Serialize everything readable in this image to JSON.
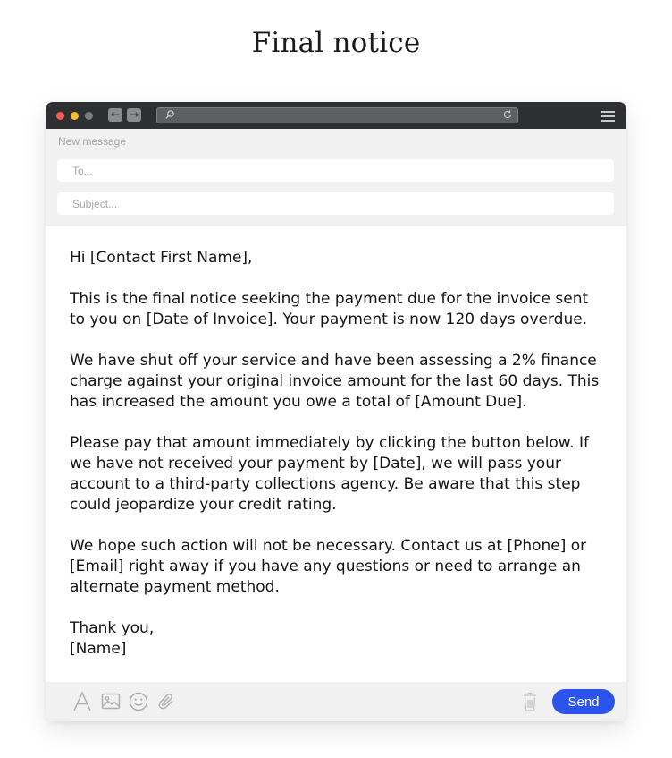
{
  "page": {
    "title": "Final notice"
  },
  "window": {
    "icons": {
      "back": "arrow-left-icon",
      "forward": "arrow-right-icon",
      "search": "search-icon",
      "reload": "reload-icon",
      "menu": "hamburger-menu-icon"
    }
  },
  "compose": {
    "header_label": "New message",
    "to_placeholder": "To...",
    "subject_placeholder": "Subject..."
  },
  "message": {
    "paragraphs": [
      "Hi [Contact First Name],",
      "This is the final notice seeking the payment due for the invoice sent to you on [Date of Invoice]. Your payment is now 120 days overdue.",
      "We have shut off your service and have been assessing a 2% finance charge against your original invoice amount for the last 60 days. This has increased the amount you owe a total of [Amount Due].",
      "Please pay that amount immediately by clicking the button below. If we have not received your payment by [Date], we will pass your account to a third-party collections agency. Be aware that this step could jeopardize your credit rating.",
      "We hope such action will not be necessary. Contact us at [Phone] or [Email] right away if you have any questions or need to arrange an alternate payment method.",
      "Thank you,\n[Name]"
    ]
  },
  "toolbar": {
    "send_label": "Send",
    "icons": [
      "font-icon",
      "image-icon",
      "emoji-icon",
      "attachment-icon",
      "trash-icon"
    ]
  },
  "colors": {
    "titlebar": "#2e2f32",
    "close": "#fd5a4f",
    "minimize": "#f3bd2e",
    "send": "#2b54ec",
    "panel": "#f1f1f2"
  }
}
